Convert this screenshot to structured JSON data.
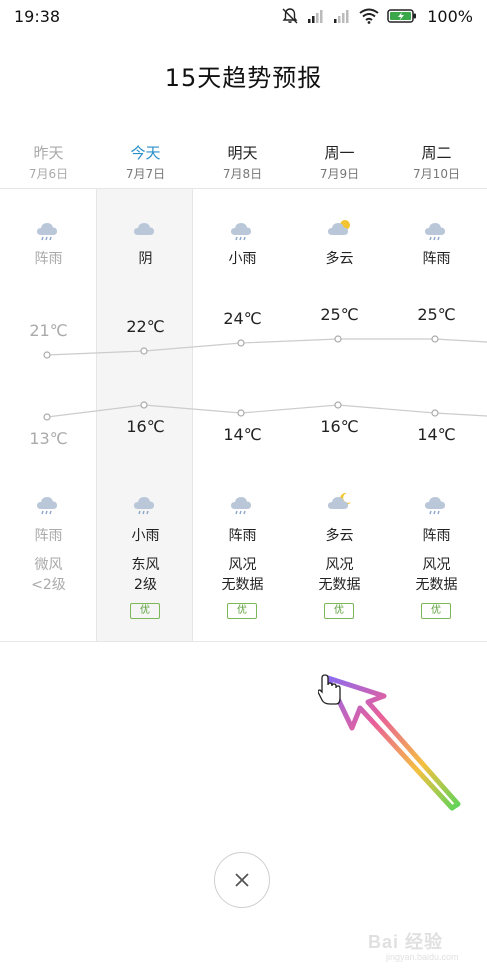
{
  "status_bar": {
    "time": "19:38",
    "battery_percent": "100%"
  },
  "title": "15天趋势预报",
  "days": [
    {
      "name": "昨天",
      "date": "7月6日",
      "day_condition": "阵雨",
      "day_icon": "shower-icon",
      "high": "21℃",
      "low": "13℃",
      "night_condition": "阵雨",
      "night_icon": "shower-icon",
      "wind_dir": "微风",
      "wind_level": "<2级",
      "aqi": "",
      "is_past": true,
      "is_today": false
    },
    {
      "name": "今天",
      "date": "7月7日",
      "day_condition": "阴",
      "day_icon": "overcast-icon",
      "high": "22℃",
      "low": "16℃",
      "night_condition": "小雨",
      "night_icon": "light-rain-icon",
      "wind_dir": "东风",
      "wind_level": "2级",
      "aqi": "优",
      "is_past": false,
      "is_today": true
    },
    {
      "name": "明天",
      "date": "7月8日",
      "day_condition": "小雨",
      "day_icon": "light-rain-icon",
      "high": "24℃",
      "low": "14℃",
      "night_condition": "阵雨",
      "night_icon": "shower-icon",
      "wind_dir": "风况",
      "wind_level": "无数据",
      "aqi": "优",
      "is_past": false,
      "is_today": false
    },
    {
      "name": "周一",
      "date": "7月9日",
      "day_condition": "多云",
      "day_icon": "partly-cloudy-icon",
      "high": "25℃",
      "low": "16℃",
      "night_condition": "多云",
      "night_icon": "partly-cloudy-night-icon",
      "wind_dir": "风况",
      "wind_level": "无数据",
      "aqi": "优",
      "is_past": false,
      "is_today": false
    },
    {
      "name": "周二",
      "date": "7月10日",
      "day_condition": "阵雨",
      "day_icon": "shower-icon",
      "high": "25℃",
      "low": "14℃",
      "night_condition": "阵雨",
      "night_icon": "shower-icon",
      "wind_dir": "风况",
      "wind_level": "无数据",
      "aqi": "优",
      "is_past": false,
      "is_today": false
    }
  ],
  "temperature_series": {
    "high_values": [
      21,
      22,
      24,
      25,
      25
    ],
    "low_values": [
      13,
      16,
      14,
      16,
      14
    ]
  },
  "colors": {
    "today_accent": "#2a8fc9",
    "aqi_good": "#5aa03a",
    "past_text": "#aaaaaa"
  },
  "close_button": {
    "label": "×"
  },
  "watermark": {
    "text": "Bai 经验",
    "sub": "jingyan.baidu.com"
  }
}
